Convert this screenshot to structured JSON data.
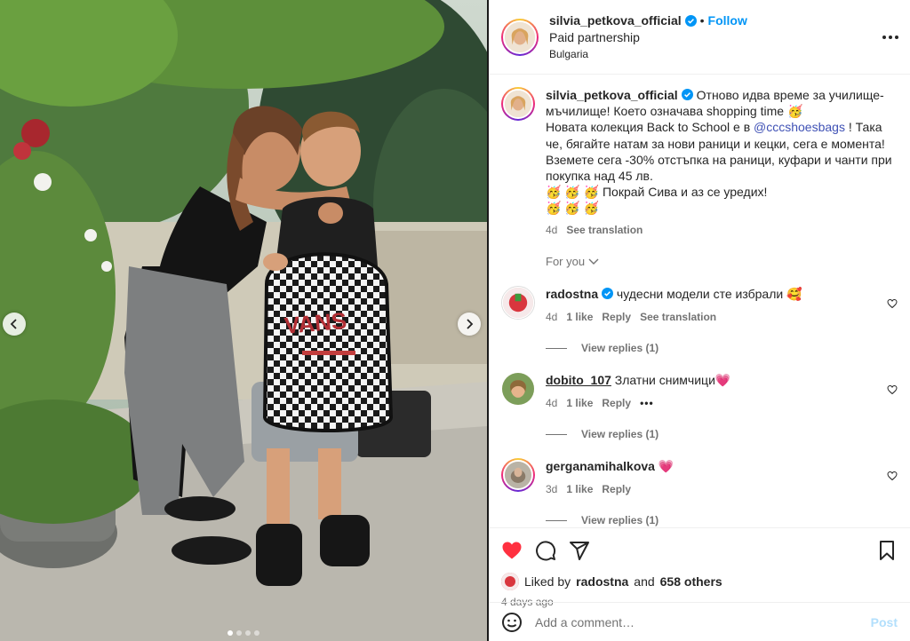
{
  "post": {
    "author": "silvia_petkova_official",
    "follow_label": "Follow",
    "separator": "•",
    "partnership": "Paid partnership",
    "location": "Bulgaria"
  },
  "caption": {
    "username": "silvia_petkova_official",
    "line1": "Отново идва време за училище-мъчилище! Което означава shopping time 🥳",
    "line2_pre": "Новата колекция Back to School е в ",
    "mention": "@cccshoesbags",
    "line2_post": " ! Така че, бягайте натам за нови раници и кецки, сега е момента! Вземете сега -30% отстъпка на раници, куфари и чанти при покупка над 45 лв.",
    "line3": "🥳 🥳 🥳 Покрай Сива и аз се уредих!",
    "line4": "🥳 🥳 🥳",
    "time": "4d",
    "see_translation": "See translation"
  },
  "for_you": "For you",
  "comments": [
    {
      "username": "radostna",
      "verified": true,
      "text": "чудесни модели сте избрали 🥰",
      "time": "4d",
      "likes": "1 like",
      "reply": "Reply",
      "translation": "See translation",
      "view_replies": "View replies (1)"
    },
    {
      "username": "dobito_107",
      "verified": false,
      "text": "Златни снимчици💗",
      "time": "4d",
      "likes": "1 like",
      "reply": "Reply",
      "more": "•••",
      "view_replies": "View replies (1)"
    },
    {
      "username": "gerganamihalkova",
      "verified": false,
      "text": "💗",
      "time": "3d",
      "likes": "1 like",
      "reply": "Reply",
      "view_replies": "View replies (1)"
    }
  ],
  "actions": {
    "liked_by_prefix": "Liked by",
    "liked_by_user": "radostna",
    "liked_by_and": "and",
    "others": "658 others",
    "time_ago": "4 days ago"
  },
  "add_comment": {
    "placeholder": "Add a comment…",
    "post_label": "Post"
  },
  "icons": {
    "like": "heart-filled-icon",
    "comment": "comment-bubble-icon",
    "share": "paper-plane-icon",
    "save": "bookmark-icon",
    "emoji": "smiley-icon",
    "more": "more-horizontal-icon"
  },
  "colors": {
    "like_red": "#ff3040",
    "link_blue": "#0095f6",
    "verified_blue": "#0095f6"
  }
}
